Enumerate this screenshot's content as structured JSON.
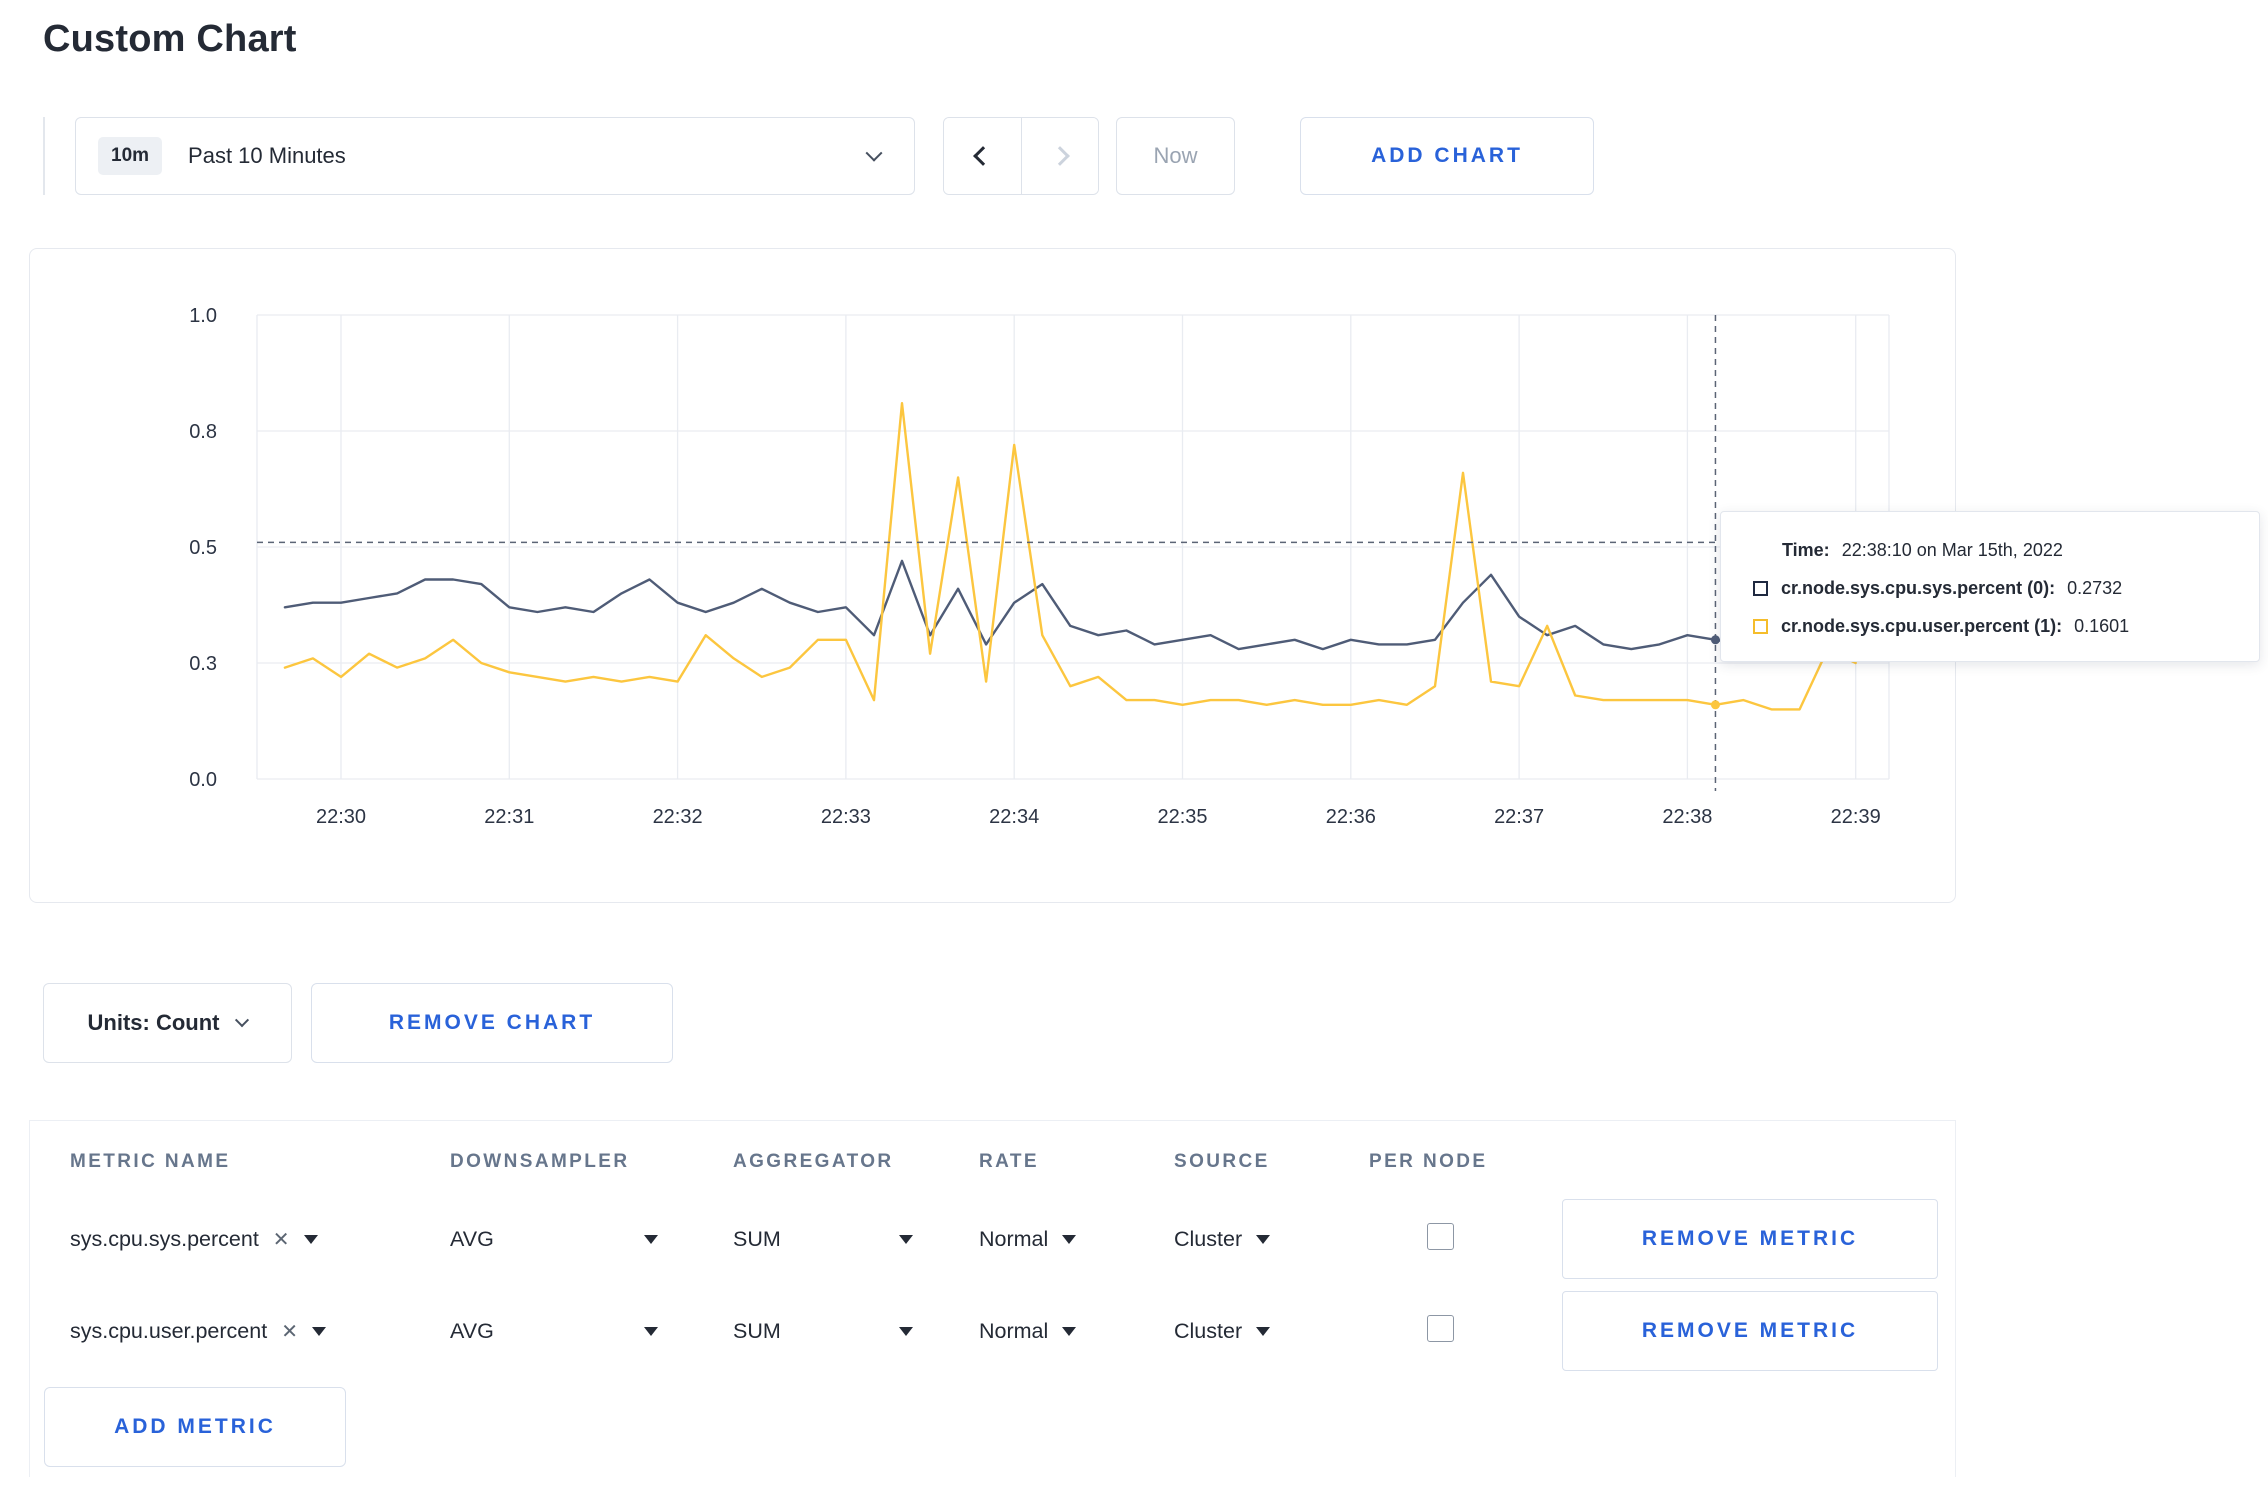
{
  "title": "Custom Chart",
  "colors": {
    "accent_blue": "#2962d9",
    "series_sys_line": "#4f5c77",
    "series_user_line": "#fcc63f"
  },
  "icons": {
    "clear": "✕"
  },
  "toolbar": {
    "time_badge": "10m",
    "time_label": "Past 10 Minutes",
    "now_label": "Now",
    "add_chart_label": "ADD CHART"
  },
  "tooltip": {
    "time_label": "Time:",
    "time_value": "22:38:10 on Mar 15th, 2022",
    "series": [
      {
        "label": "cr.node.sys.cpu.sys.percent (0):",
        "value": "0.2732",
        "color": "#1f2940"
      },
      {
        "label": "cr.node.sys.cpu.user.percent (1):",
        "value": "0.1601",
        "color": "#f5bd2b"
      }
    ]
  },
  "chart_data": {
    "type": "line",
    "title": "",
    "ylim": [
      0,
      1
    ],
    "y_ticks": [
      "1.0",
      "0.8",
      "0.5",
      "0.3",
      "0.0"
    ],
    "y_tick_values": [
      1.0,
      0.75,
      0.5,
      0.25,
      0.0
    ],
    "x_ticks": [
      "22:30",
      "22:31",
      "22:32",
      "22:33",
      "22:34",
      "22:35",
      "22:36",
      "22:37",
      "22:38",
      "22:39"
    ],
    "x_start": "22:29:40",
    "x_interval_seconds": 10,
    "grid": true,
    "crosshair": {
      "time": "22:38:10",
      "x_index": 51,
      "y_value": 0.51
    },
    "series": [
      {
        "name": "cr.node.sys.cpu.sys.percent",
        "color": "#4f5c77",
        "values": [
          0.37,
          0.38,
          0.38,
          0.39,
          0.4,
          0.43,
          0.43,
          0.42,
          0.37,
          0.36,
          0.37,
          0.36,
          0.4,
          0.43,
          0.38,
          0.36,
          0.38,
          0.41,
          0.38,
          0.36,
          0.37,
          0.31,
          0.47,
          0.31,
          0.41,
          0.29,
          0.38,
          0.42,
          0.33,
          0.31,
          0.32,
          0.29,
          0.3,
          0.31,
          0.28,
          0.29,
          0.3,
          0.28,
          0.3,
          0.29,
          0.29,
          0.3,
          0.38,
          0.44,
          0.35,
          0.31,
          0.33,
          0.29,
          0.28,
          0.29,
          0.31,
          0.3,
          0.29,
          0.31,
          0.33,
          0.3,
          0.31
        ]
      },
      {
        "name": "cr.node.sys.cpu.user.percent",
        "color": "#fcc63f",
        "values": [
          0.24,
          0.26,
          0.22,
          0.27,
          0.24,
          0.26,
          0.3,
          0.25,
          0.23,
          0.22,
          0.21,
          0.22,
          0.21,
          0.22,
          0.21,
          0.31,
          0.26,
          0.22,
          0.24,
          0.3,
          0.3,
          0.17,
          0.81,
          0.27,
          0.65,
          0.21,
          0.72,
          0.31,
          0.2,
          0.22,
          0.17,
          0.17,
          0.16,
          0.17,
          0.17,
          0.16,
          0.17,
          0.16,
          0.16,
          0.17,
          0.16,
          0.2,
          0.66,
          0.21,
          0.2,
          0.33,
          0.18,
          0.17,
          0.17,
          0.17,
          0.17,
          0.16,
          0.17,
          0.15,
          0.15,
          0.28,
          0.25
        ]
      }
    ]
  },
  "chart_actions": {
    "units_label": "Units: Count",
    "remove_chart_label": "REMOVE CHART"
  },
  "metrics_table": {
    "headers": [
      "METRIC NAME",
      "DOWNSAMPLER",
      "AGGREGATOR",
      "RATE",
      "SOURCE",
      "PER NODE"
    ],
    "rows": [
      {
        "metric": "sys.cpu.sys.percent",
        "downsampler": "AVG",
        "aggregator": "SUM",
        "rate": "Normal",
        "source": "Cluster",
        "per_node": false,
        "remove_label": "REMOVE METRIC"
      },
      {
        "metric": "sys.cpu.user.percent",
        "downsampler": "AVG",
        "aggregator": "SUM",
        "rate": "Normal",
        "source": "Cluster",
        "per_node": false,
        "remove_label": "REMOVE METRIC"
      }
    ],
    "add_metric_label": "ADD METRIC"
  }
}
